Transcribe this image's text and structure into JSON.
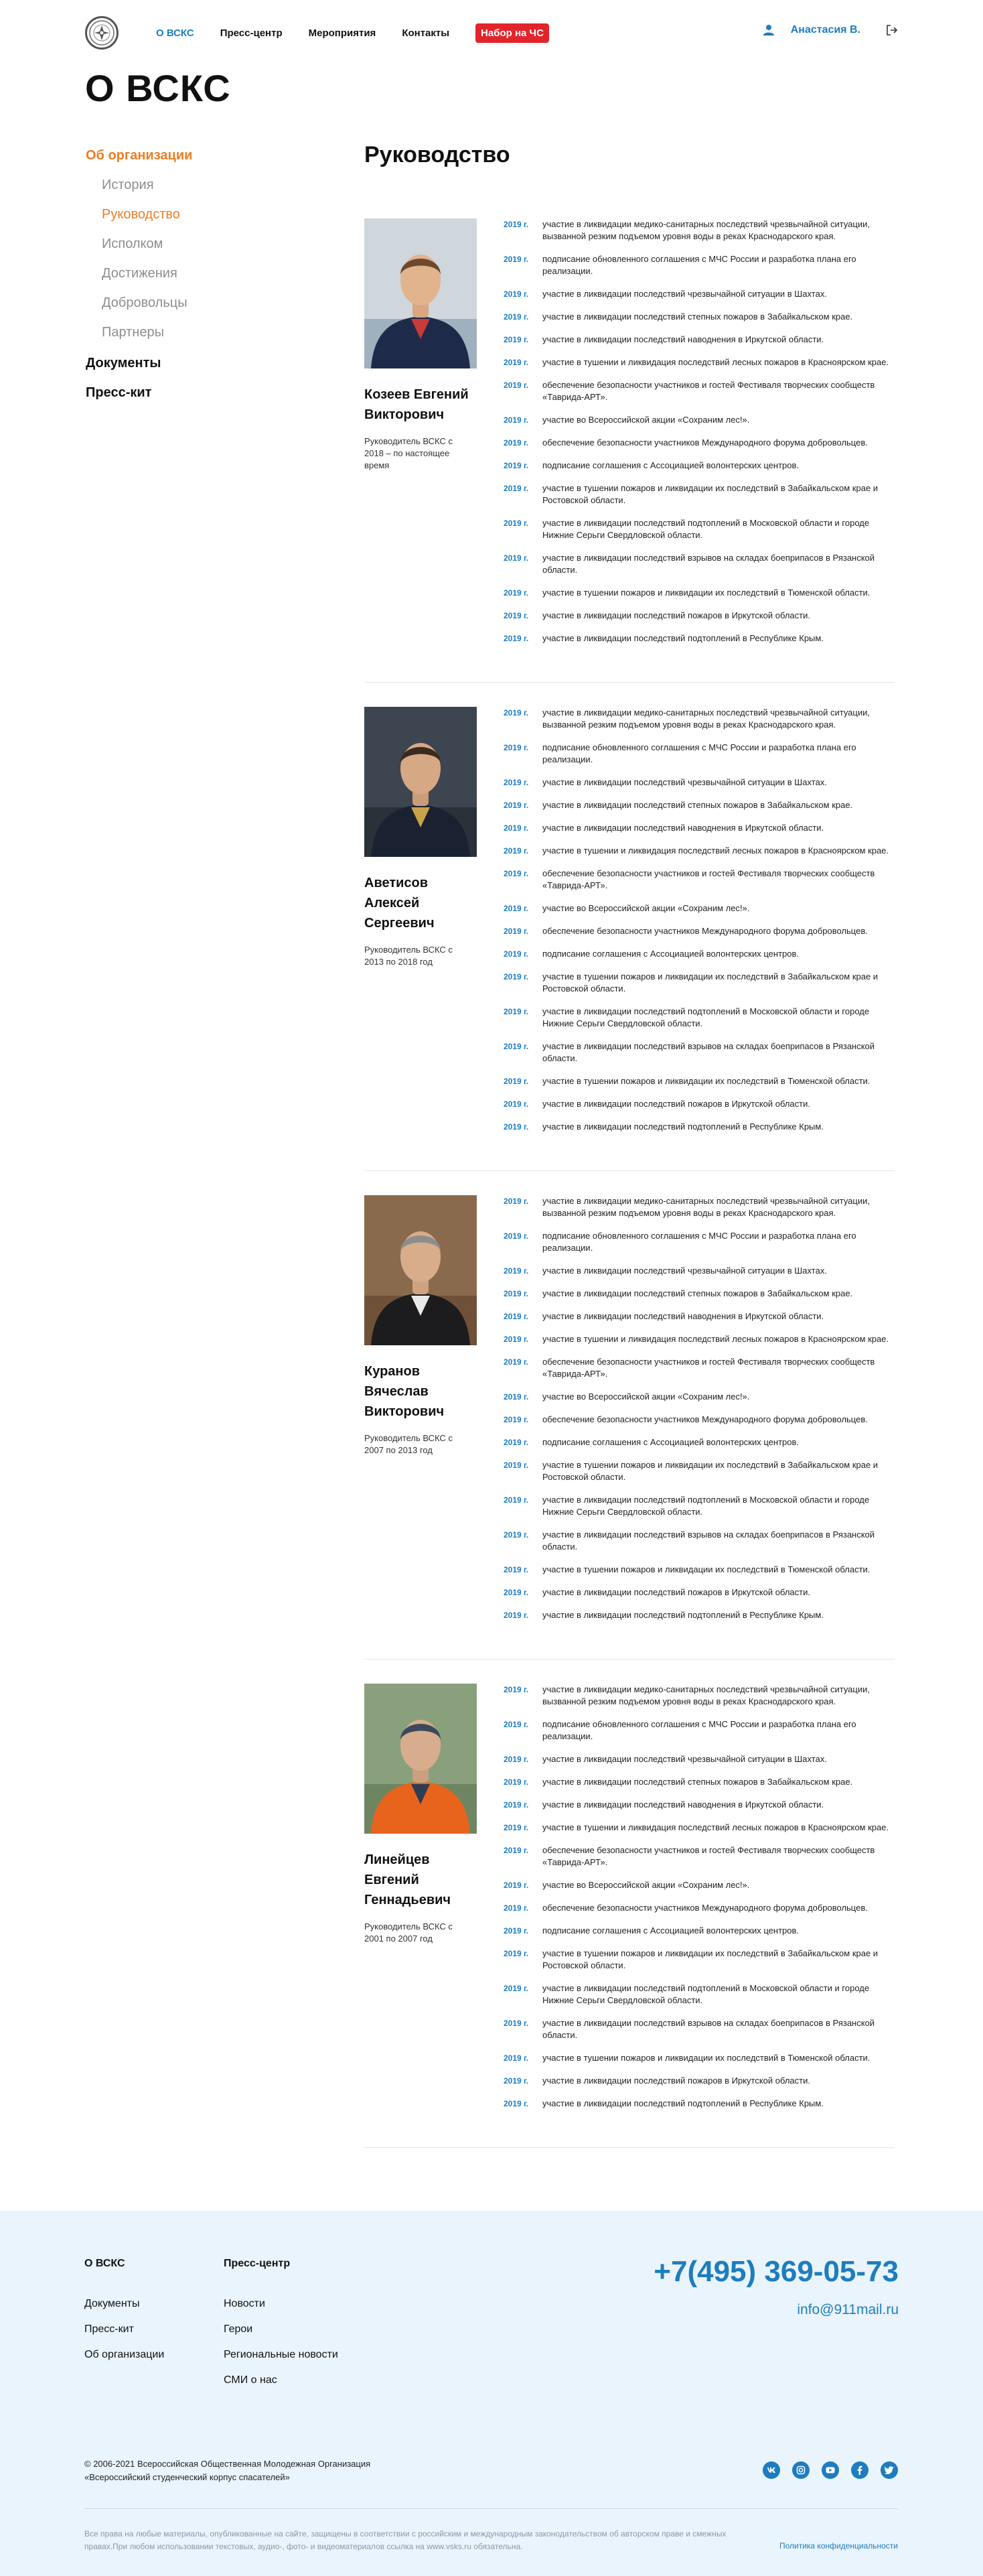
{
  "header": {
    "logo_icon": "vsks-emblem-icon",
    "nav": [
      {
        "label": "О ВСКС",
        "active": true
      },
      {
        "label": "Пресс-центр",
        "active": false
      },
      {
        "label": "Мероприятия",
        "active": false
      },
      {
        "label": "Контакты",
        "active": false
      }
    ],
    "cta_label": "Набор на ЧС",
    "user_icon": "user-icon",
    "user_name": "Анастасия В.",
    "logout_icon": "logout-icon"
  },
  "page_title": "О ВСКС",
  "sidebar": {
    "section_label": "Об организации",
    "items": [
      {
        "label": "История",
        "active": false
      },
      {
        "label": "Руководство",
        "active": true
      },
      {
        "label": "Исполком",
        "active": false
      },
      {
        "label": "Достижения",
        "active": false
      },
      {
        "label": "Добровольцы",
        "active": false
      },
      {
        "label": "Партнеры",
        "active": false
      }
    ],
    "links": [
      "Документы",
      "Пресс-кит"
    ]
  },
  "content": {
    "title": "Руководство",
    "leaders": [
      {
        "name": "Козеев Евгений Викторович",
        "role": "Руководитель ВСКС с 2018 – по настоящее время",
        "photo": "photo-kozeev"
      },
      {
        "name": "Аветисов Алексей Сергеевич",
        "role": "Руководитель ВСКС с 2013 по 2018 год",
        "photo": "photo-avetisov"
      },
      {
        "name": "Куранов Вячеслав Викторович",
        "role": "Руководитель ВСКС с 2007 по 2013 год",
        "photo": "photo-kuranov"
      },
      {
        "name": "Линейцев Евгений Геннадьевич",
        "role": "Руководитель ВСКС с 2001 по 2007 год",
        "photo": "photo-lineytsev"
      }
    ],
    "timeline": [
      {
        "year": "2019 г.",
        "text": "участие в ликвидации медико-санитарных последствий чрезвычайной ситуации, вызванной резким подъемом уровня воды в реках Краснодарского края."
      },
      {
        "year": "2019 г.",
        "text": "подписание обновленного соглашения с МЧС России и разработка плана его реализации."
      },
      {
        "year": "2019 г.",
        "text": "участие в ликвидации последствий чрезвычайной ситуации в Шахтах."
      },
      {
        "year": "2019 г.",
        "text": "участие в ликвидации последствий степных пожаров в Забайкальском крае."
      },
      {
        "year": "2019 г.",
        "text": "участие в ликвидации последствий наводнения в Иркутской области."
      },
      {
        "year": "2019 г.",
        "text": "участие в тушении и ликвидация последствий лесных пожаров в Красноярском крае."
      },
      {
        "year": "2019 г.",
        "text": "обеспечение безопасности участников и гостей Фестиваля творческих сообществ «Таврида-АРТ»."
      },
      {
        "year": "2019 г.",
        "text": "участие во Всероссийской акции «Сохраним лес!»."
      },
      {
        "year": "2019 г.",
        "text": "обеспечение безопасности участников Международного форума добровольцев."
      },
      {
        "year": "2019 г.",
        "text": "подписание соглашения с Ассоциацией волонтерских центров."
      },
      {
        "year": "2019 г.",
        "text": "участие в тушении пожаров и ликвидации их последствий в Забайкальском крае и Ростовской области."
      },
      {
        "year": "2019 г.",
        "text": "участие в ликвидации последствий подтоплений в Московской области и городе Нижние Серьги Свердловской области."
      },
      {
        "year": "2019 г.",
        "text": "участие в ликвидации последствий взрывов на складах боеприпасов в Рязанской области."
      },
      {
        "year": "2019 г.",
        "text": "участие в тушении пожаров и ликвидации их последствий в Тюменской области."
      },
      {
        "year": "2019 г.",
        "text": "участие в ликвидации последствий пожаров в Иркутской области."
      },
      {
        "year": "2019 г.",
        "text": "участие в ликвидации последствий подтоплений в Республике Крым."
      }
    ]
  },
  "footer": {
    "col1": {
      "title": "О ВСКС",
      "links": [
        "Документы",
        "Пресс-кит",
        "Об организации"
      ]
    },
    "col2": {
      "title": "Пресс-центр",
      "links": [
        "Новости",
        "Герои",
        "Региональные новости",
        "СМИ о нас"
      ]
    },
    "phone": "+7(495) 369-05-73",
    "email": "info@911mail.ru",
    "copyright_line1": "© 2006-2021 Всероссийская Общественная Молодежная Организация",
    "copyright_line2": "«Всероссийский студенческий корпус спасателей»",
    "socials": [
      "vk-icon",
      "instagram-icon",
      "youtube-icon",
      "facebook-icon",
      "twitter-icon"
    ],
    "legal": "Все права на любые материалы, опубликованные на сайте, защищены в соответствии с российским и международным законодательством об авторском праве и смежных правах.При любом использовании текстовых, аудио-, фото- и видеоматериалов ссылка на www.vsks.ru обязательна.",
    "policy": "Политика конфиденциальности"
  }
}
